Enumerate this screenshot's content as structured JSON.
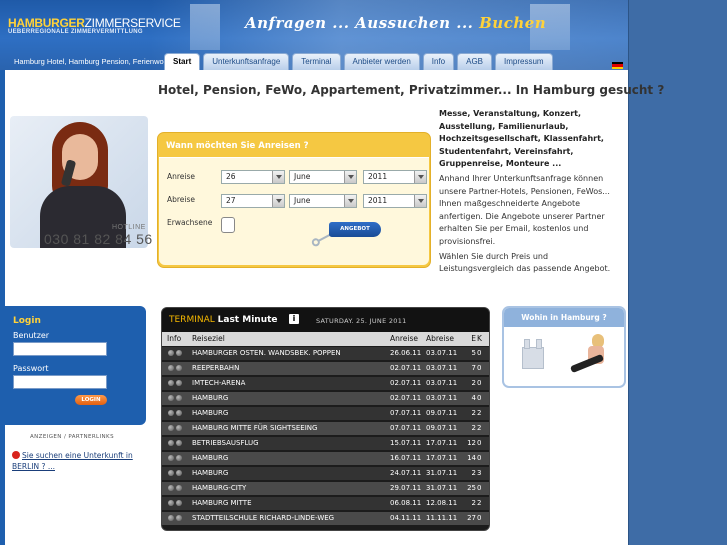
{
  "header": {
    "logo_main": "HAMBURGER",
    "logo_second": "ZIMMERSERVICE",
    "logo_sub": "UEBERREGIONALE ZIMMERVERMITTLUNG",
    "slogan_a": "Anfragen ... Aussuchen ... ",
    "slogan_b": "Buchen",
    "subnav_text": "Hamburg Hotel, Hamburg Pension, Ferienwo",
    "tabs": [
      {
        "label": "Start"
      },
      {
        "label": "Unterkunftsanfrage"
      },
      {
        "label": "Terminal"
      },
      {
        "label": "Anbieter werden"
      },
      {
        "label": "Info"
      },
      {
        "label": "AGB"
      },
      {
        "label": "Impressum"
      }
    ],
    "flag_colors": [
      "#000000",
      "#dd0000",
      "#ffce00"
    ]
  },
  "hotline": {
    "label": "HOTLINE",
    "number": "030 81 82 84 56"
  },
  "login": {
    "title": "Login",
    "user_label": "Benutzer",
    "pass_label": "Passwort",
    "button": "LOGIN"
  },
  "ads": {
    "label": "ANZEIGEN / PARTNERLINKS",
    "link": "Sie suchen eine Unterkunft in BERLIN ? ..."
  },
  "headline": "Hotel, Pension, FeWo, Appartement, Privatzimmer... In Hamburg gesucht ?",
  "form": {
    "title": "Wann möchten Sie Anreisen ?",
    "anreise_label": "Anreise",
    "abreise_label": "Abreise",
    "erwachsene_label": "Erwachsene",
    "anreise": {
      "day": "26",
      "month": "June",
      "year": "2011"
    },
    "abreise": {
      "day": "27",
      "month": "June",
      "year": "2011"
    },
    "button": "ANGEBOT"
  },
  "description": {
    "bold": "Messe, Veranstaltung, Konzert, Ausstellung, Familienurlaub, Hochzeitsgesellschaft, Klassenfahrt, Studentenfahrt, Vereinsfahrt, Gruppenreise, Monteure ...",
    "text1": "Anhand Ihrer Unterkunftsanfrage können unsere Partner-Hotels, Pensionen, FeWos... Ihnen maßgeschneiderte Angebote anfertigen. Die Angebote unserer Partner erhalten Sie per Email, kostenlos und provisionsfrei.",
    "text2": "Wählen Sie durch Preis und Leistungsvergleich das passende Angebot."
  },
  "terminal": {
    "title_a": "TERMINAL",
    "title_b": "Last Minute",
    "info_icon": "i",
    "date": "SATURDAY. 25. JUNE 2011",
    "columns": {
      "info": "Info",
      "ziel": "Reiseziel",
      "anreise": "Anreise",
      "abreise": "Abreise",
      "e": "E",
      "k": "K"
    },
    "rows": [
      {
        "ziel": "Hamburger Osten. Wandsbek. Poppen",
        "an": "26.06.11",
        "ab": "03.07.11",
        "e": "5",
        "k": "0"
      },
      {
        "ziel": "Reeperbahn",
        "an": "02.07.11",
        "ab": "03.07.11",
        "e": "7",
        "k": "0"
      },
      {
        "ziel": "Imtech-Arena",
        "an": "02.07.11",
        "ab": "03.07.11",
        "e": "2",
        "k": "0"
      },
      {
        "ziel": "Hamburg",
        "an": "02.07.11",
        "ab": "03.07.11",
        "e": "4",
        "k": "0"
      },
      {
        "ziel": "Hamburg",
        "an": "07.07.11",
        "ab": "09.07.11",
        "e": "2",
        "k": "2"
      },
      {
        "ziel": "Hamburg Mitte Für Sightseeing",
        "an": "07.07.11",
        "ab": "09.07.11",
        "e": "2",
        "k": "2"
      },
      {
        "ziel": "Betriebsausflug",
        "an": "15.07.11",
        "ab": "17.07.11",
        "e": "12",
        "k": "0"
      },
      {
        "ziel": "Hamburg",
        "an": "16.07.11",
        "ab": "17.07.11",
        "e": "14",
        "k": "0"
      },
      {
        "ziel": "Hamburg",
        "an": "24.07.11",
        "ab": "31.07.11",
        "e": "2",
        "k": "3"
      },
      {
        "ziel": "Hamburg-City",
        "an": "29.07.11",
        "ab": "31.07.11",
        "e": "25",
        "k": "0"
      },
      {
        "ziel": "Hamburg Mitte",
        "an": "06.08.11",
        "ab": "12.08.11",
        "e": "2",
        "k": "2"
      },
      {
        "ziel": "Stadtteilschule Richard-Linde-Weg",
        "an": "04.11.11",
        "ab": "11.11.11",
        "e": "27",
        "k": "0"
      }
    ]
  },
  "wohin": {
    "title": "Wohin in Hamburg ?"
  }
}
